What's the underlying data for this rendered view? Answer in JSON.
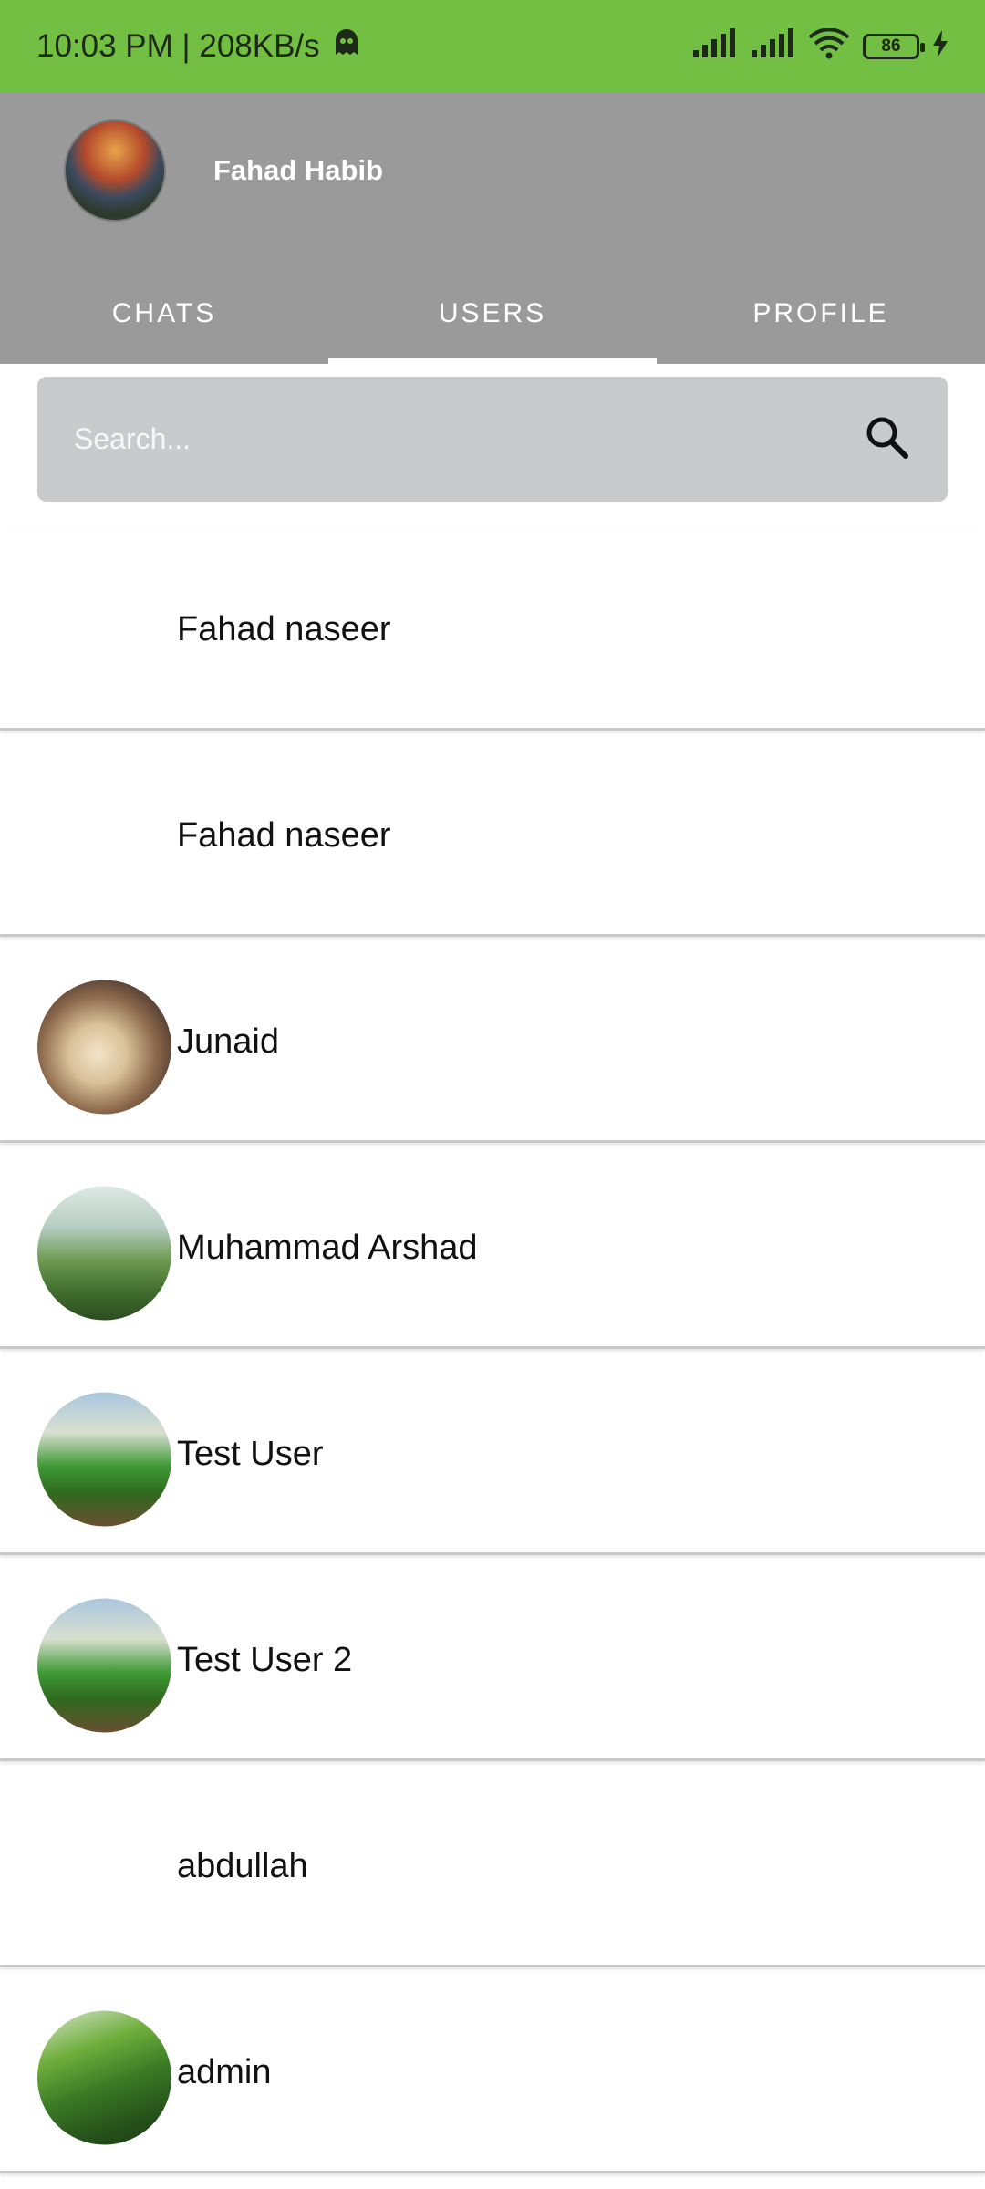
{
  "status_bar": {
    "time_speed": "10:03 PM | 208KB/s",
    "battery": "86",
    "icons": [
      "ghost-icon",
      "signal-icon",
      "signal-icon",
      "wifi-icon",
      "battery-icon",
      "charging-icon"
    ]
  },
  "header": {
    "user_name": "Fahad Habib",
    "tabs": [
      {
        "label": "CHATS"
      },
      {
        "label": "USERS"
      },
      {
        "label": "PROFILE"
      }
    ],
    "active_tab": "USERS"
  },
  "search": {
    "placeholder": "Search..."
  },
  "users": [
    {
      "name": "Fahad naseer",
      "has_avatar": false
    },
    {
      "name": "Fahad naseer",
      "has_avatar": false
    },
    {
      "name": "Junaid",
      "has_avatar": true
    },
    {
      "name": "Muhammad Arshad",
      "has_avatar": true
    },
    {
      "name": "Test User",
      "has_avatar": true
    },
    {
      "name": "Test User 2",
      "has_avatar": true
    },
    {
      "name": "abdullah",
      "has_avatar": false
    },
    {
      "name": "admin",
      "has_avatar": true
    }
  ],
  "colors": {
    "status_bar": "#72bf44",
    "header": "#9a9a9a",
    "search_bg": "#c9cacc"
  }
}
